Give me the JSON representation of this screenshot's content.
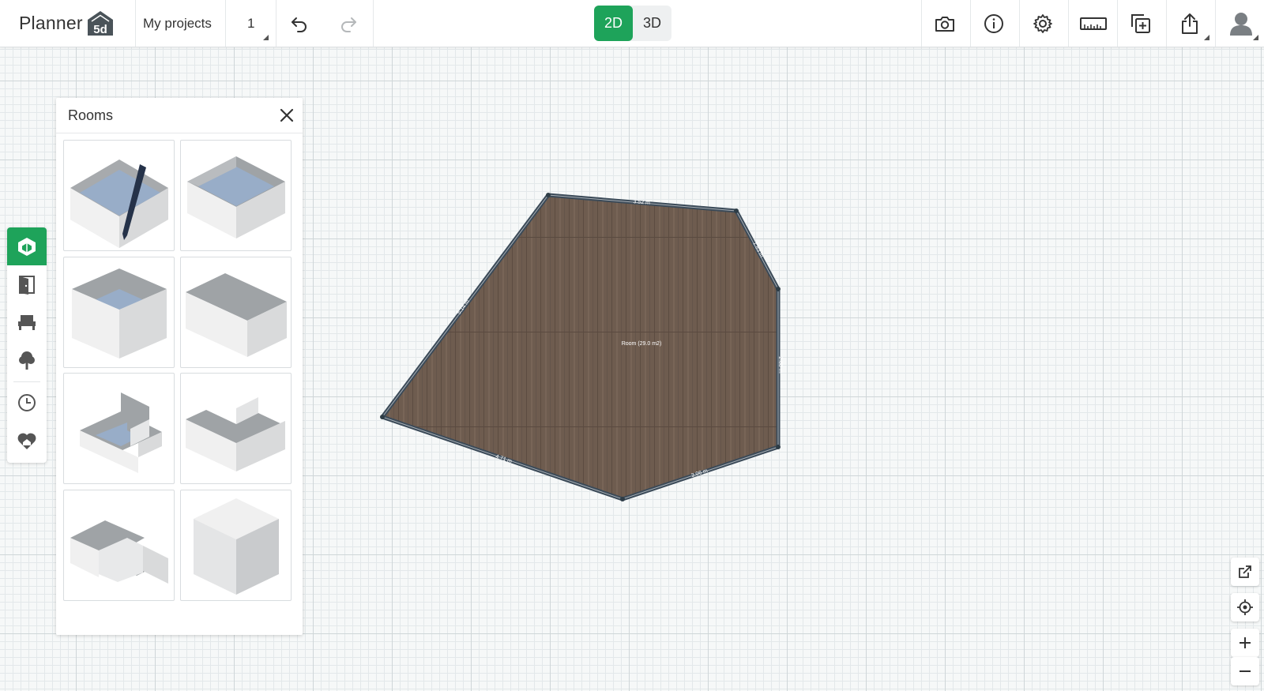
{
  "header": {
    "logo_text": "Planner",
    "logo_mark": "5d",
    "my_projects": "My projects",
    "floor_number": "1",
    "view_2d": "2D",
    "view_3d": "3D"
  },
  "icons": {
    "undo": "undo-icon",
    "redo": "redo-icon",
    "camera": "camera-icon",
    "info": "info-icon",
    "settings": "gear-icon",
    "ruler": "ruler-icon",
    "add_layer": "add-copy-icon",
    "share": "share-icon",
    "user": "user-avatar-icon"
  },
  "left_toolbar": [
    "rooms-icon",
    "doors-icon",
    "furniture-icon",
    "outdoor-tree-icon",
    "history-clock-icon",
    "favorites-heart-home-icon"
  ],
  "rooms_panel": {
    "title": "Rooms",
    "tiles": [
      "draw-room",
      "rectangular-room",
      "deep-rectangular-room",
      "wide-rectangular-room",
      "notched-room",
      "u-shaped-room",
      "l-shaped-room",
      "solid-block"
    ]
  },
  "plan": {
    "room_label": "Room (29.0 m2)",
    "dimensions": {
      "top": "3.52 m",
      "upper_right": "1.83 m",
      "right": "2.88 m",
      "lower_right": "3.06 m",
      "bottom_left": "4.71 m",
      "left": "5.14 m"
    },
    "colors": {
      "floor": "#6b5a4d",
      "wall": "#3b4a58",
      "accent": "#1ea35a"
    }
  },
  "right_tools": [
    "open-external-icon",
    "locate-center-icon",
    "zoom-in-icon",
    "zoom-out-icon"
  ]
}
